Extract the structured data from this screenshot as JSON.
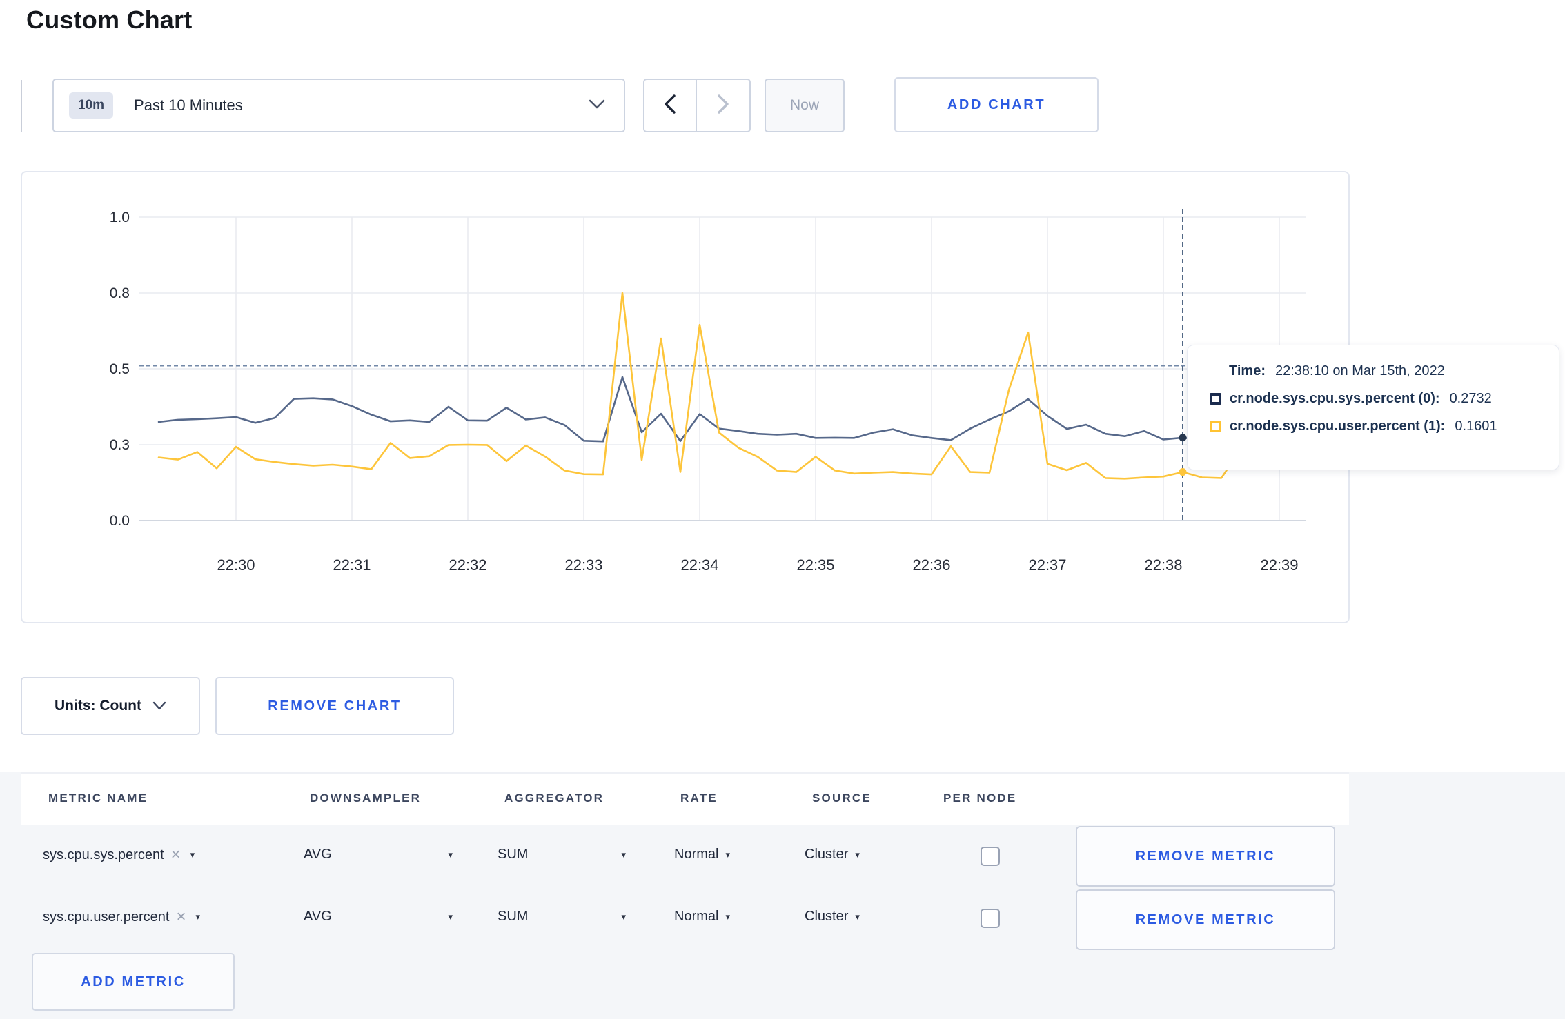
{
  "page": {
    "title": "Custom Chart"
  },
  "toolbar": {
    "time_window": {
      "badge": "10m",
      "label": "Past 10 Minutes"
    },
    "now_label": "Now",
    "add_chart_label": "ADD CHART"
  },
  "icons": {
    "caret_down": "▾",
    "remove_x": "×"
  },
  "tooltip": {
    "time_label": "Time:",
    "time_value": "22:38:10 on Mar 15th, 2022",
    "rows": [
      {
        "label": "cr.node.sys.cpu.sys.percent (0):",
        "value": "0.2732",
        "color": "#1a2b4e"
      },
      {
        "label": "cr.node.sys.cpu.user.percent (1):",
        "value": "0.1601",
        "color": "#ffc333"
      }
    ]
  },
  "chart_controls": {
    "units_label": "Units: Count",
    "remove_chart_label": "REMOVE CHART"
  },
  "metrics_table": {
    "headers": [
      "METRIC NAME",
      "DOWNSAMPLER",
      "AGGREGATOR",
      "RATE",
      "SOURCE",
      "PER NODE"
    ],
    "rows": [
      {
        "metric": "sys.cpu.sys.percent",
        "downsampler": "AVG",
        "aggregator": "SUM",
        "rate": "Normal",
        "source": "Cluster",
        "per_node_checked": false,
        "remove_label": "REMOVE METRIC"
      },
      {
        "metric": "sys.cpu.user.percent",
        "downsampler": "AVG",
        "aggregator": "SUM",
        "rate": "Normal",
        "source": "Cluster",
        "per_node_checked": false,
        "remove_label": "REMOVE METRIC"
      }
    ],
    "add_metric_label": "ADD METRIC"
  },
  "chart_data": {
    "type": "line",
    "title": "",
    "xlabel": "",
    "ylabel": "",
    "ylim": [
      0,
      1
    ],
    "grid": true,
    "y_ticks": [
      {
        "label": "0.0",
        "value": 0
      },
      {
        "label": "0.3",
        "value": 0.25
      },
      {
        "label": "0.5",
        "value": 0.5
      },
      {
        "label": "0.8",
        "value": 0.75
      },
      {
        "label": "1.0",
        "value": 1.0
      }
    ],
    "x_ticks": [
      "22:30",
      "22:31",
      "22:32",
      "22:33",
      "22:34",
      "22:35",
      "22:36",
      "22:37",
      "22:38",
      "22:39"
    ],
    "x_times": [
      "22:29:20",
      "22:29:30",
      "22:29:40",
      "22:29:50",
      "22:30:00",
      "22:30:10",
      "22:30:20",
      "22:30:30",
      "22:30:40",
      "22:30:50",
      "22:31:00",
      "22:31:10",
      "22:31:20",
      "22:31:30",
      "22:31:40",
      "22:31:50",
      "22:32:00",
      "22:32:10",
      "22:32:20",
      "22:32:30",
      "22:32:40",
      "22:32:50",
      "22:33:00",
      "22:33:10",
      "22:33:20",
      "22:33:30",
      "22:33:40",
      "22:33:50",
      "22:34:00",
      "22:34:10",
      "22:34:20",
      "22:34:30",
      "22:34:40",
      "22:34:50",
      "22:35:00",
      "22:35:10",
      "22:35:20",
      "22:35:30",
      "22:35:40",
      "22:35:50",
      "22:36:00",
      "22:36:10",
      "22:36:20",
      "22:36:30",
      "22:36:40",
      "22:36:50",
      "22:37:00",
      "22:37:10",
      "22:37:20",
      "22:37:30",
      "22:37:40",
      "22:37:50",
      "22:38:00",
      "22:38:10",
      "22:38:20",
      "22:38:30",
      "22:38:40",
      "22:38:50",
      "22:39:00",
      "22:39:10"
    ],
    "series": [
      {
        "name": "cr.node.sys.cpu.sys.percent",
        "color": "#56688a",
        "values": [
          0.325,
          0.332,
          0.334,
          0.337,
          0.341,
          0.322,
          0.338,
          0.401,
          0.403,
          0.399,
          0.377,
          0.349,
          0.327,
          0.33,
          0.325,
          0.375,
          0.33,
          0.329,
          0.372,
          0.333,
          0.34,
          0.315,
          0.263,
          0.261,
          0.473,
          0.291,
          0.352,
          0.262,
          0.351,
          0.303,
          0.295,
          0.286,
          0.283,
          0.286,
          0.272,
          0.273,
          0.272,
          0.29,
          0.301,
          0.281,
          0.272,
          0.265,
          0.303,
          0.333,
          0.36,
          0.4,
          0.345,
          0.302,
          0.316,
          0.286,
          0.278,
          0.295,
          0.267,
          0.2732,
          0.265,
          0.272,
          0.285,
          0.28,
          0.292,
          0.3
        ]
      },
      {
        "name": "cr.node.sys.cpu.user.percent",
        "color": "#fdc53b",
        "values": [
          0.208,
          0.201,
          0.226,
          0.172,
          0.243,
          0.202,
          0.193,
          0.186,
          0.181,
          0.184,
          0.178,
          0.169,
          0.256,
          0.206,
          0.212,
          0.249,
          0.25,
          0.249,
          0.196,
          0.247,
          0.211,
          0.165,
          0.153,
          0.152,
          0.75,
          0.2,
          0.6,
          0.16,
          0.645,
          0.29,
          0.24,
          0.21,
          0.165,
          0.16,
          0.21,
          0.165,
          0.155,
          0.158,
          0.16,
          0.155,
          0.152,
          0.245,
          0.16,
          0.158,
          0.43,
          0.62,
          0.187,
          0.166,
          0.19,
          0.14,
          0.138,
          0.142,
          0.145,
          0.1601,
          0.142,
          0.14,
          0.235,
          0.24,
          0.19,
          0.27
        ]
      }
    ],
    "hover": {
      "time": "22:38:10",
      "crosshair_value": 0.51,
      "points": [
        {
          "series": 0,
          "value": 0.2732
        },
        {
          "series": 1,
          "value": 0.1601
        }
      ]
    },
    "legend_position": "tooltip"
  }
}
